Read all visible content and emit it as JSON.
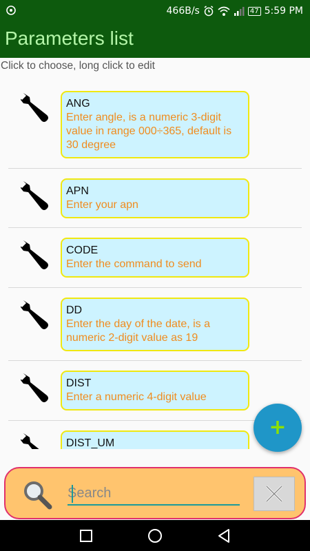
{
  "status_bar": {
    "net_speed": "466B/s",
    "battery": "47",
    "time": "5:59 PM"
  },
  "app_bar": {
    "title": "Parameters list"
  },
  "hint": "Click to choose, long click to edit",
  "parameters": [
    {
      "name": "ANG",
      "description": "Enter angle, is a numeric 3-digit value in range 000÷365, default is 30 degree"
    },
    {
      "name": "APN",
      "description": "Enter your apn"
    },
    {
      "name": "CODE",
      "description": "Enter the command to send"
    },
    {
      "name": "DD",
      "description": "Enter the day of the date, is a numeric 2-digit value as 19"
    },
    {
      "name": "DIST",
      "description": "Enter a numeric 4-digit value"
    },
    {
      "name": "DIST_UM",
      "description": ""
    }
  ],
  "fab": {
    "label": "+"
  },
  "search": {
    "placeholder": "Search",
    "value": ""
  },
  "colors": {
    "app_bar": "#0d5a0d",
    "title_text": "#b4f5a8",
    "card_bg": "#cdf3ff",
    "card_border": "#f0e810",
    "description_text": "#f08c1e",
    "fab": "#1f96c8",
    "search_bg": "#ffc46e",
    "search_border": "#e0306c"
  },
  "icons": {
    "status_left": "alarm-clock-icon",
    "list_item": "wrench-icon",
    "search": "magnifier-icon",
    "clear": "close-icon"
  }
}
